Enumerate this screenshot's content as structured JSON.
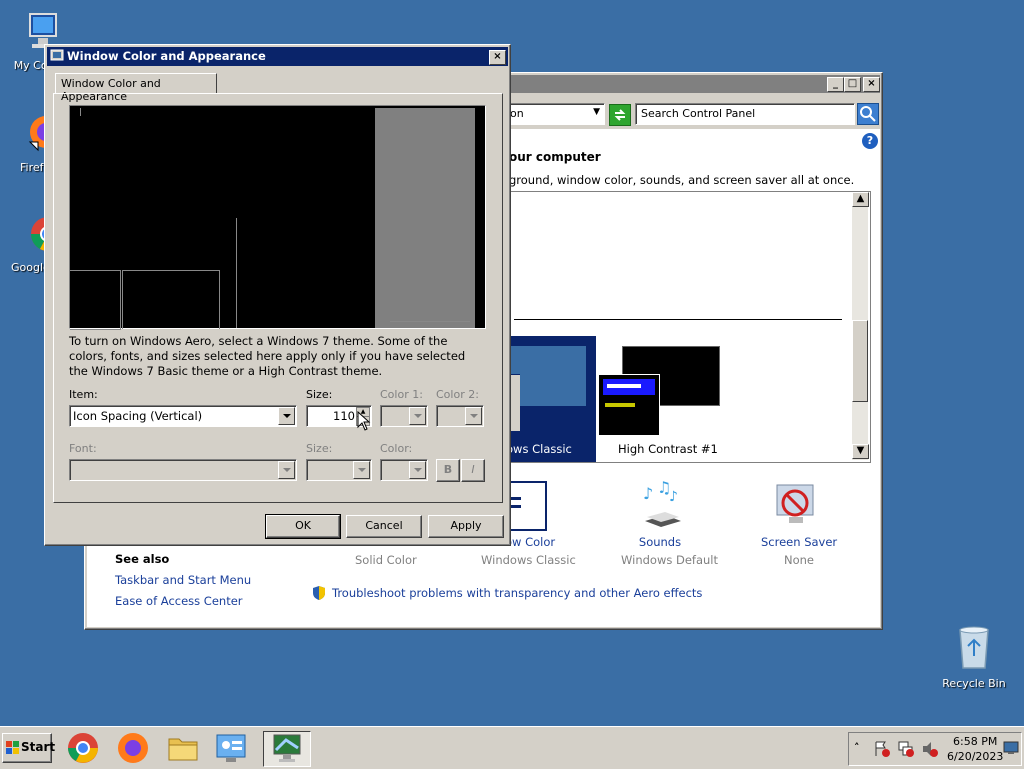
{
  "desktop": {
    "icons": [
      {
        "label": "My Com",
        "icon": "computer-icon"
      },
      {
        "label": "Firef",
        "icon": "firefox-icon"
      },
      {
        "label": "Google C",
        "icon": "chrome-icon"
      },
      {
        "label": "Recycle Bin",
        "icon": "recycle-bin-icon"
      }
    ]
  },
  "control_panel": {
    "address_fragment": "on",
    "search_placeholder": "Search Control Panel",
    "heading_fragment": "our computer",
    "desc_fragment": "ground, window color, sounds, and screen saver all at once.",
    "themes": [
      {
        "label": "ows Classic"
      },
      {
        "label": "High Contrast #1"
      }
    ],
    "items": [
      {
        "title": "ow Color",
        "sub": "Windows Classic"
      },
      {
        "title": "Sounds",
        "sub": "Windows Default"
      },
      {
        "title": "Screen Saver",
        "sub": "None"
      }
    ],
    "partial_sub": "Solid Color",
    "see_also": {
      "title": "See also",
      "links": [
        "Taskbar and Start Menu",
        "Ease of Access Center"
      ]
    },
    "troubleshoot": "Troubleshoot problems with transparency and other Aero effects"
  },
  "dialog": {
    "title": "Window Color and Appearance",
    "tab": "Window Color and Appearance",
    "info": "To turn on Windows Aero, select a Windows 7 theme.  Some of the colors, fonts, and sizes selected here apply only if you have selected the Windows 7 Basic theme or a High Contrast theme.",
    "item_label": "Item:",
    "item_value": "Icon Spacing (Vertical)",
    "size_label": "Size:",
    "size_value": "110",
    "color1_label": "Color 1:",
    "color2_label": "Color 2:",
    "font_label": "Font:",
    "font_size_label": "Size:",
    "font_color_label": "Color:",
    "bold": "B",
    "italic": "I",
    "ok": "OK",
    "cancel": "Cancel",
    "apply": "Apply"
  },
  "taskbar": {
    "start": "Start",
    "time": "6:58 PM",
    "date": "6/20/2023"
  },
  "colors": {
    "desktop": "#3a6ea5",
    "titlebar_inactive": "#808080",
    "titlebar_active": "#0a246a",
    "face": "#d4d0c8"
  }
}
